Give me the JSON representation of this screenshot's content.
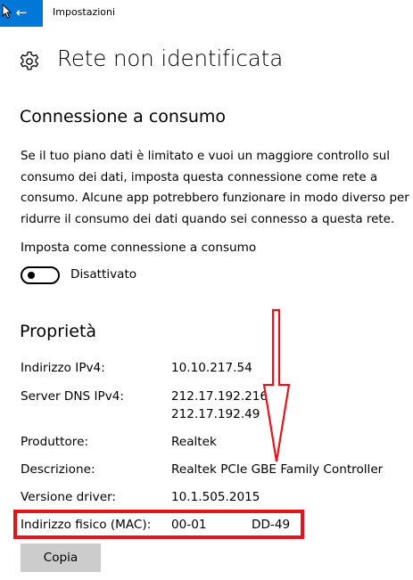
{
  "window": {
    "app_title": "Impostazioni"
  },
  "header": {
    "title": "Rete non identificata"
  },
  "metered": {
    "heading": "Connessione a consumo",
    "description": "Se il tuo piano dati è limitato e vuoi un maggiore controllo sul consumo dei dati, imposta questa connessione come rete a consumo. Alcune app potrebbero funzionare in modo diverso per ridurre il consumo dei dati quando sei connesso a questa rete.",
    "setting_label": "Imposta come connessione a consumo",
    "toggle_state": "Disattivato",
    "toggle_on": false
  },
  "properties": {
    "heading": "Proprietà",
    "rows": [
      {
        "label": "Indirizzo IPv4:",
        "value": "10.10.217.54"
      },
      {
        "label": "Server DNS IPv4:",
        "value": "212.17.192.216",
        "value2": "212.17.192.49"
      },
      {
        "label": "Produttore:",
        "value": "Realtek"
      },
      {
        "label": "Descrizione:",
        "value": "Realtek PCIe GBE Family Controller"
      },
      {
        "label": "Versione driver:",
        "value": "10.1.505.2015"
      },
      {
        "label": "Indirizzo fisico (MAC):",
        "value": "00-01",
        "value_end": "DD-49"
      }
    ],
    "copy_label": "Copia"
  },
  "colors": {
    "accent": "#0078d7",
    "highlight": "#e4141d",
    "button_bg": "#cccccc"
  },
  "icons": [
    "back-arrow-icon",
    "mouse-cursor-icon",
    "gear-icon",
    "down-arrow-annotation"
  ]
}
